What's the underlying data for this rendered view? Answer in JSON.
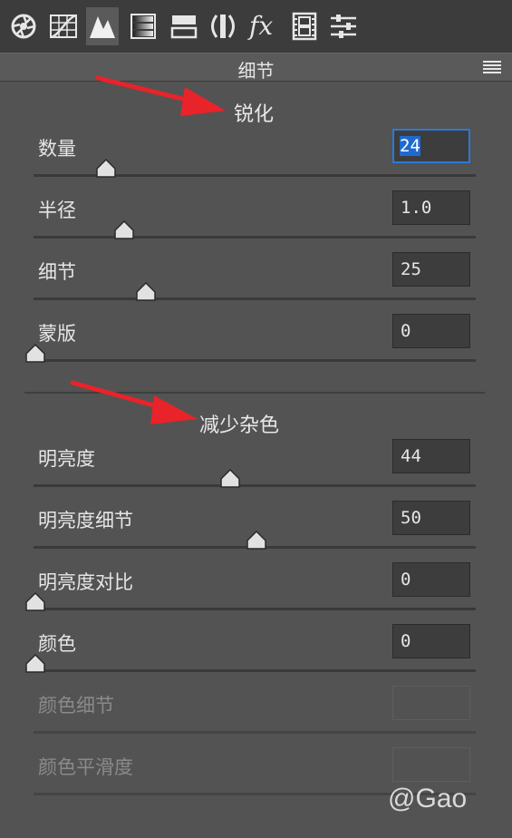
{
  "toolbar": {
    "tools": [
      {
        "name": "aperture-icon",
        "active": false
      },
      {
        "name": "tone-curve-icon",
        "active": false
      },
      {
        "name": "detail-icon",
        "active": true
      },
      {
        "name": "hsl-icon",
        "active": false
      },
      {
        "name": "split-toning-icon",
        "active": false
      },
      {
        "name": "lens-corrections-icon",
        "active": false
      },
      {
        "name": "fx-icon",
        "active": false
      },
      {
        "name": "camera-calibration-icon",
        "active": false
      },
      {
        "name": "presets-icon",
        "active": false
      }
    ]
  },
  "panel": {
    "title": "细节",
    "menu_icon": "hamburger-menu-icon"
  },
  "sharpening": {
    "title": "锐化",
    "sliders": [
      {
        "label": "数量",
        "value": "24",
        "level": 0.16,
        "focused": true
      },
      {
        "label": "半径",
        "value": "1.0",
        "level": 0.2
      },
      {
        "label": "细节",
        "value": "25",
        "level": 0.25
      },
      {
        "label": "蒙版",
        "value": "0",
        "level": 0.0
      }
    ]
  },
  "noise_reduction": {
    "title": "减少杂色",
    "sliders": [
      {
        "label": "明亮度",
        "value": "44",
        "level": 0.44
      },
      {
        "label": "明亮度细节",
        "value": "50",
        "level": 0.5
      },
      {
        "label": "明亮度对比",
        "value": "0",
        "level": 0.0
      },
      {
        "label": "颜色",
        "value": "0",
        "level": 0.0
      },
      {
        "label": "颜色细节",
        "value": "",
        "disabled": true
      },
      {
        "label": "颜色平滑度",
        "value": "",
        "disabled": true
      }
    ]
  },
  "watermark": "@Gao",
  "colors": {
    "accent_focus": "#2b7ad6",
    "arrow": "#e8232a",
    "panel_bg": "#535353"
  }
}
